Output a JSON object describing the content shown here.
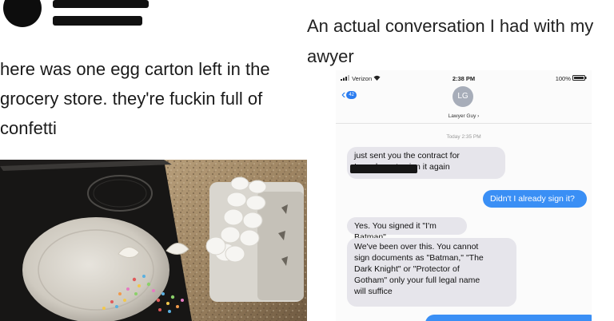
{
  "tweet": {
    "text": "here was one egg carton left in the\ngrocery store. they're fuckin full of\nconfetti"
  },
  "caption": {
    "text": "An actual conversation I had with my\nawyer"
  },
  "phone": {
    "carrier": "Verizon",
    "time": "2:38 PM",
    "battery": "100%",
    "back_count": "42",
    "contact_initials": "LG",
    "contact_name": "Lawyer Guy",
    "timestamp": "Today 2:35 PM",
    "messages": [
      {
        "from": "contact",
        "text": "just sent you the contract for\n I need you to sign it again"
      },
      {
        "from": "me",
        "text": "Didn't I already sign it?"
      },
      {
        "from": "contact",
        "text": "Yes. You signed it \"I'm Batman\""
      },
      {
        "from": "contact",
        "text": "We've been over this. You cannot\nsign documents as \"Batman,\" \"The\nDark Knight\" or \"Protector of\nGotham\" only your full legal name\nwill suffice"
      }
    ]
  },
  "colors": {
    "imessage_blue": "#3a8ff5",
    "received_gray": "#e6e5eb",
    "link_blue": "#1e7bf0"
  },
  "icons": [
    "signal-bars-icon",
    "wifi-icon",
    "battery-icon",
    "back-chevron-icon"
  ]
}
